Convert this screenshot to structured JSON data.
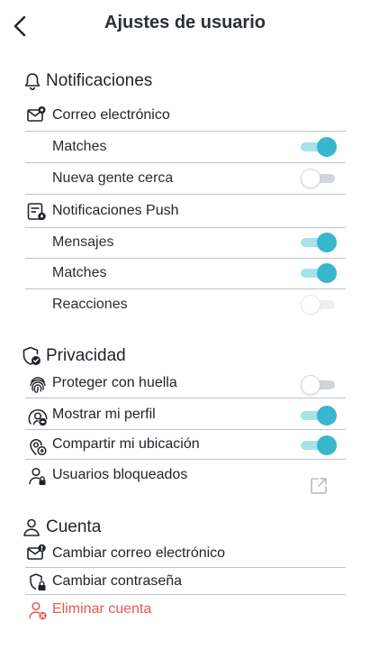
{
  "header": {
    "title": "Ajustes de usuario",
    "back_icon": "chevron-left-icon"
  },
  "notifications": {
    "title": "Notificaciones",
    "email_label": "Correo electrónico",
    "email_matches": {
      "label": "Matches",
      "on": true
    },
    "email_new_people": {
      "label": "Nueva gente cerca",
      "on": false
    },
    "push_label": "Notificaciones Push",
    "push_messages": {
      "label": "Mensajes",
      "on": true
    },
    "push_matches": {
      "label": "Matches",
      "on": true
    },
    "push_reactions": {
      "label": "Reacciones",
      "on": false
    }
  },
  "privacy": {
    "title": "Privacidad",
    "fingerprint": {
      "label": "Proteger con huella",
      "on": false
    },
    "show_profile": {
      "label": "Mostrar mi perfil",
      "on": true
    },
    "share_location": {
      "label": "Compartir mi ubicación",
      "on": true
    },
    "blocked_users": {
      "label": "Usuarios bloqueados"
    }
  },
  "account": {
    "title": "Cuenta",
    "change_email": "Cambiar correo electrónico",
    "change_password": "Cambiar contraseña",
    "delete_account": "Eliminar cuenta"
  },
  "colors": {
    "accent": "#38b6cc",
    "accent_track": "#a6e2ea",
    "danger": "#e8584f"
  }
}
